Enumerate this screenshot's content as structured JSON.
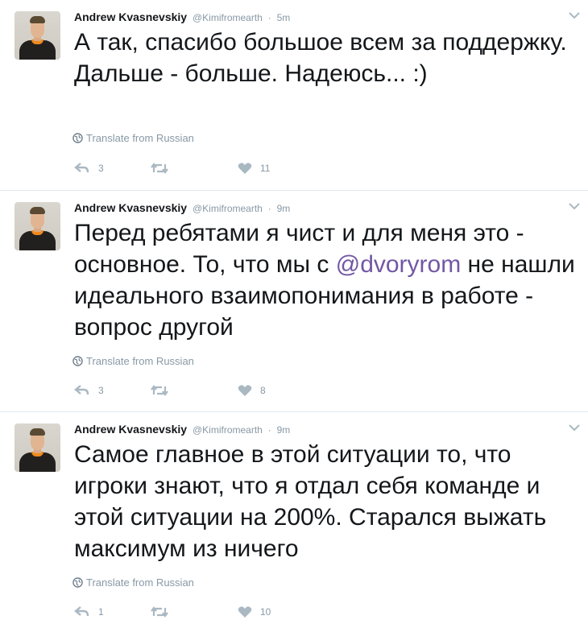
{
  "tweets": [
    {
      "name": "Andrew Kvasnevskiy",
      "handle": "@Kimifromearth",
      "separator": "·",
      "time": "5m",
      "text": "А так, спасибо большое всем за поддержку. Дальше - больше. Надеюсь... :)",
      "translate": "Translate from Russian",
      "replies": "3",
      "retweets": "",
      "likes": "11"
    },
    {
      "name": "Andrew Kvasnevskiy",
      "handle": "@Kimifromearth",
      "separator": "·",
      "time": "9m",
      "text_before": "Перед ребятами я чист и для меня это - основное. То, что мы с ",
      "mention": "@dvoryrom",
      "text_after": " не нашли идеального взаимопонимания в работе - вопрос другой",
      "translate": "Translate from Russian",
      "replies": "3",
      "retweets": "",
      "likes": "8"
    },
    {
      "name": "Andrew Kvasnevskiy",
      "handle": "@Kimifromearth",
      "separator": "·",
      "time": "9m",
      "text": "Самое главное в этой ситуации то, что игроки знают, что я отдал себя команде и этой ситуации на 200%. Старался выжать максимум из ничего",
      "translate": "Translate from Russian",
      "replies": "1",
      "retweets": "",
      "likes": "10"
    }
  ],
  "icons": {
    "reply": "reply-icon",
    "retweet": "retweet-icon",
    "like": "heart-icon",
    "translate": "globe-icon",
    "menu": "chevron-down-icon"
  },
  "colors": {
    "text": "#14171a",
    "muted": "#8899a6",
    "mention": "#7257a4",
    "divider": "#e1e8ed"
  }
}
